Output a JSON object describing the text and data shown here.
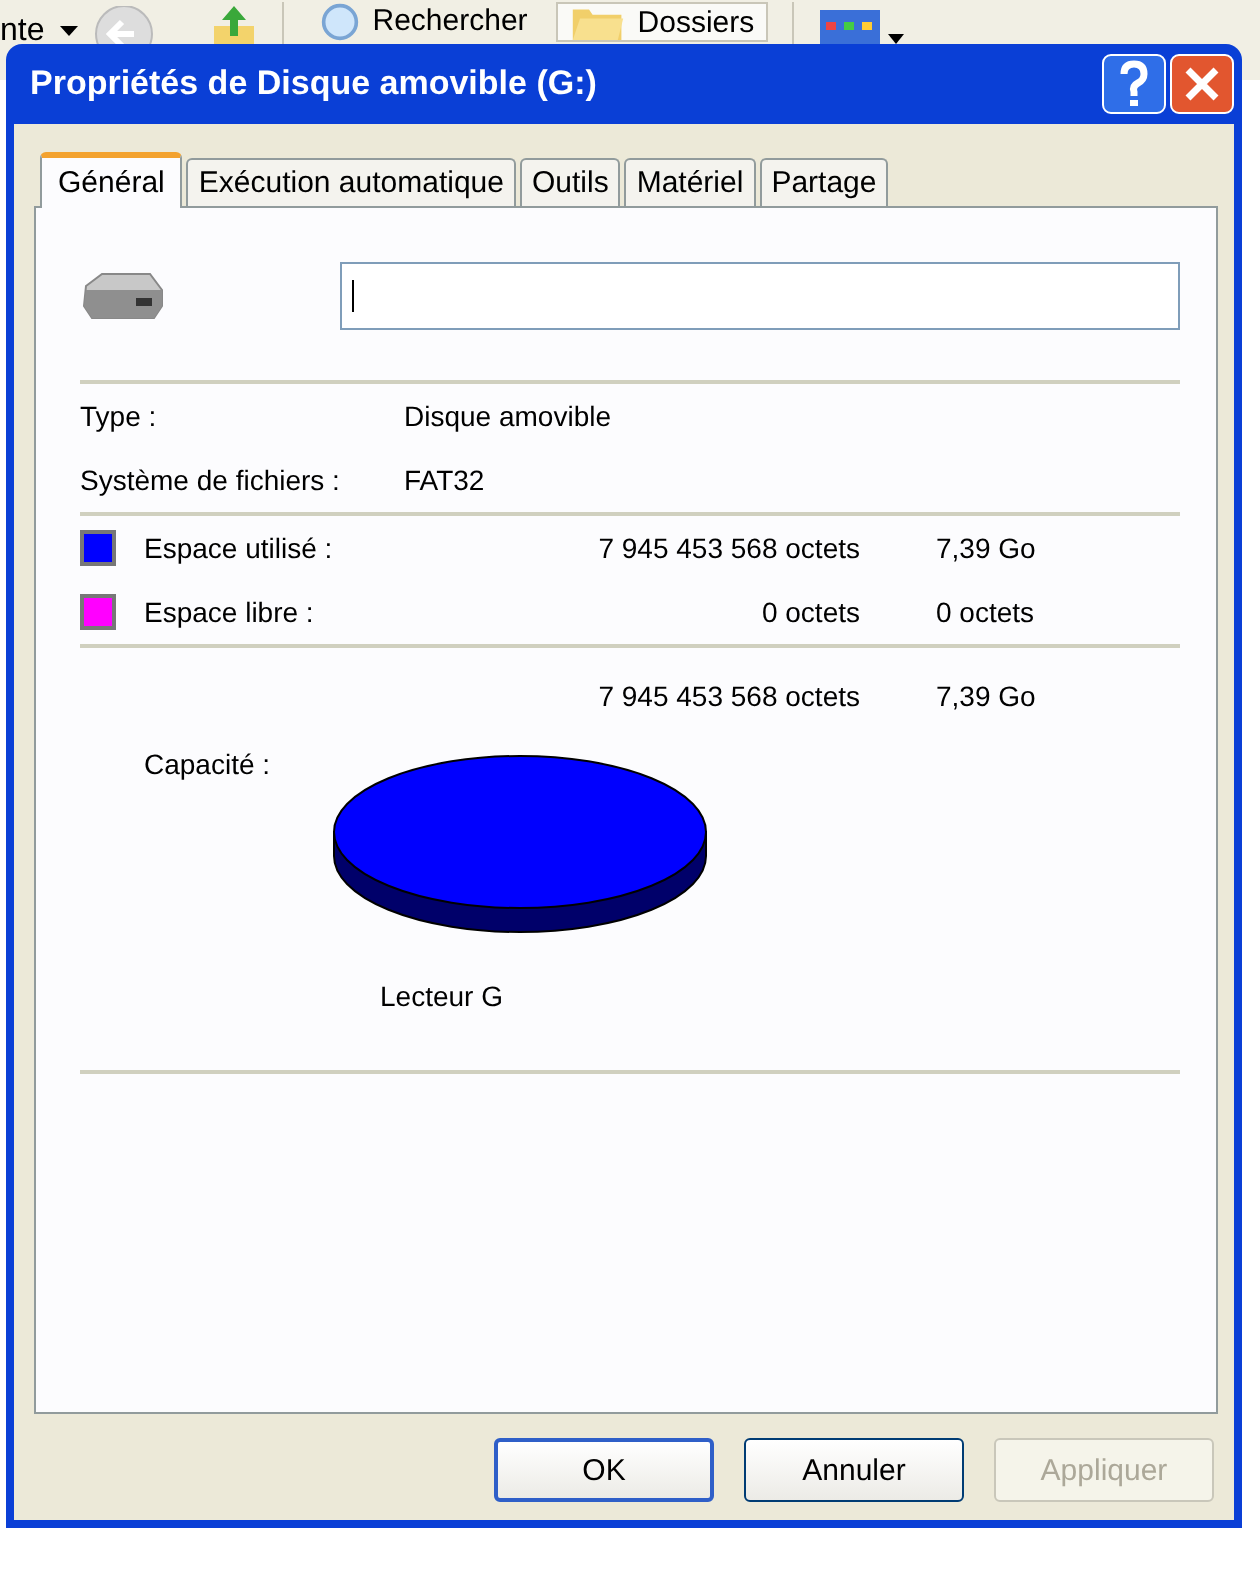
{
  "background_toolbar": {
    "items": [
      {
        "kind": "dropdown",
        "label": "nte"
      },
      {
        "kind": "back"
      },
      {
        "kind": "up"
      },
      {
        "kind": "search",
        "label": "Rechercher"
      },
      {
        "kind": "folders",
        "label": "Dossiers"
      },
      {
        "kind": "views"
      }
    ]
  },
  "window": {
    "title": "Propriétés de Disque amovible (G:)"
  },
  "tabs": [
    {
      "label": "Général",
      "selected": true
    },
    {
      "label": "Exécution automatique",
      "selected": false
    },
    {
      "label": "Outils",
      "selected": false
    },
    {
      "label": "Matériel",
      "selected": false
    },
    {
      "label": "Partage",
      "selected": false
    }
  ],
  "info": [
    {
      "label": "Type :",
      "value": "Disque amovible"
    },
    {
      "label": "Système de fichiers :",
      "value": "FAT32"
    }
  ],
  "space": [
    {
      "label": "Espace utilisé :",
      "bytes": "7 945 453 568 octets",
      "size": "7,39 Go",
      "color": "#0000ff"
    },
    {
      "label": "Espace libre :",
      "bytes": "0 octets",
      "size": "0 octets",
      "color": "#ff00ff"
    }
  ],
  "capacity": {
    "label": "Capacité :",
    "bytes": "7 945 453 568 octets",
    "size": "7,39 Go",
    "drive": "Lecteur G"
  },
  "buttons": [
    {
      "label": "OK",
      "default": true,
      "disabled": false
    },
    {
      "label": "Annuler",
      "default": false,
      "disabled": false
    },
    {
      "label": "Appliquer",
      "default": false,
      "disabled": true
    }
  ]
}
